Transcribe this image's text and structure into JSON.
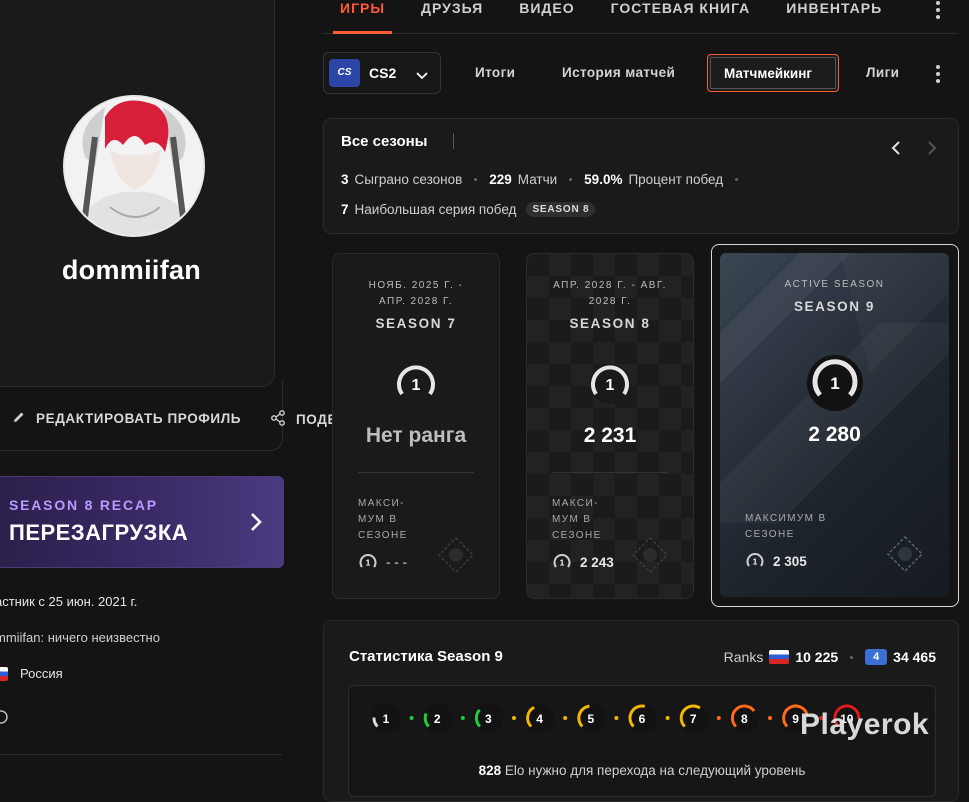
{
  "profile": {
    "username": "dommiifan",
    "edit_label": "РЕДАКТИРОВАТЬ ПРОФИЛЬ",
    "share_label": "ПОДЕЛИТЬСЯ",
    "recap": {
      "subtitle": "SEASON 8 RECAP",
      "title": "ПЕРЕЗАГРУЗКА"
    },
    "member_since": "астник с 25 июн. 2021 г.",
    "about": "mmiifan: ничего неизвестно",
    "country": "Россия"
  },
  "top_nav": {
    "items": [
      "ИГРЫ",
      "ДРУЗЬЯ",
      "ВИДЕО",
      "ГОСТЕВАЯ КНИГА",
      "ИНВЕНТАРЬ"
    ],
    "active": "ИГРЫ"
  },
  "game": {
    "logo": "CS",
    "name": "CS2"
  },
  "sub_tabs": [
    "Итоги",
    "История матчей",
    "Матчмейкинг",
    "Лиги"
  ],
  "summary": {
    "title": "Все сезоны",
    "seasons_played": "3",
    "seasons_played_label": "Сыграно сезонов",
    "matches": "229",
    "matches_label": "Матчи",
    "win_rate": "59.0%",
    "win_rate_label": "Процент побед",
    "win_streak": "7",
    "win_streak_label": "Наибольшая серия побед",
    "win_streak_badge": "SEASON 8"
  },
  "seasons": [
    {
      "date_line1": "НОЯБ. 2025 Г. -",
      "date_line2": "АПР. 2028 Г.",
      "name": "SEASON 7",
      "level": "1",
      "elo": "Нет ранга",
      "max_line1": "МАКСИ-",
      "max_line2": "МУМ В",
      "max_line3": "СЕЗОНЕ",
      "max_level": "1",
      "max_value": "- - -"
    },
    {
      "date_line1": "АПР. 2028 Г. - АВГ.",
      "date_line2": "2028 Г.",
      "name": "SEASON 8",
      "level": "1",
      "elo": "2 231",
      "max_line1": "МАКСИ-",
      "max_line2": "МУМ В",
      "max_line3": "СЕЗОНЕ",
      "max_level": "1",
      "max_value": "2 243"
    },
    {
      "date_line1": "ACTIVE SEASON",
      "name": "SEASON 9",
      "level": "1",
      "elo": "2 280",
      "max_line1": "МАКСИМУМ В",
      "max_line2": "СЕЗОНЕ",
      "max_level": "1",
      "max_value": "2 305"
    }
  ],
  "stats": {
    "title": "Статистика Season 9",
    "ranks_label": "Ranks",
    "rank_country": "10 225",
    "rank_region": "34 465",
    "levels": [
      "1",
      "2",
      "3",
      "4",
      "5",
      "6",
      "7",
      "8",
      "9",
      "10"
    ],
    "level_colors": [
      "#d9d9d9",
      "#1fce3c",
      "#1fce3c",
      "#f2b705",
      "#f2b705",
      "#f2b705",
      "#f2b705",
      "#ff6a1a",
      "#ff6a1a",
      "#e21b1b"
    ],
    "next_level_elo": "828",
    "next_level_text": "Elo нужно для перехода на следующий уровень"
  },
  "watermark": "Playerok"
}
